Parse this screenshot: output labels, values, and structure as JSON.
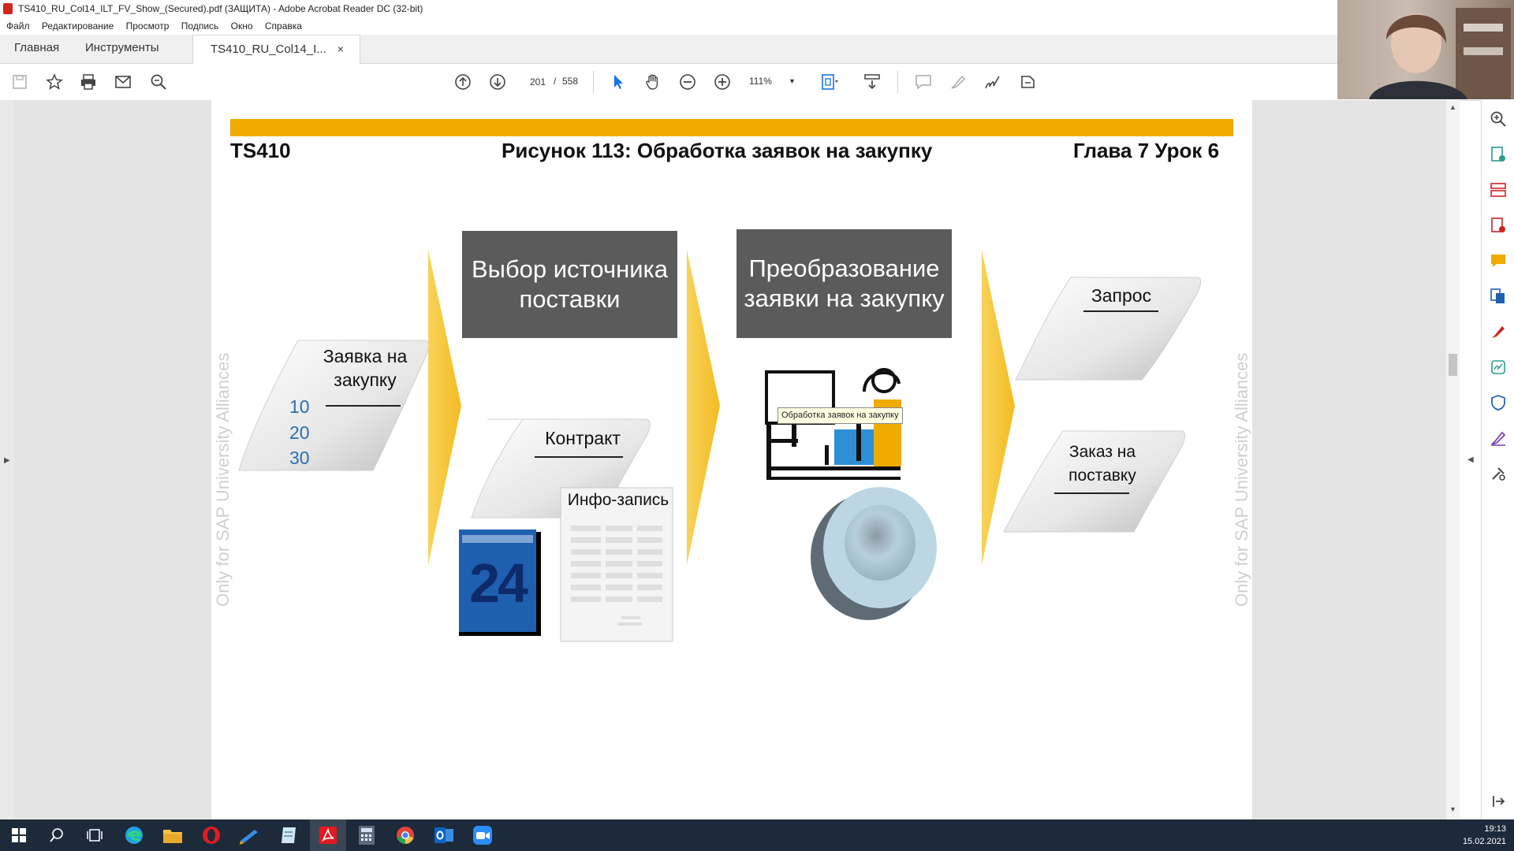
{
  "window": {
    "title": "TS410_RU_Col14_ILT_FV_Show_(Secured).pdf (ЗАЩИТА) - Adobe Acrobat Reader DC (32-bit)"
  },
  "menu": [
    "Файл",
    "Редактирование",
    "Просмотр",
    "Подпись",
    "Окно",
    "Справка"
  ],
  "tabs": {
    "home": "Главная",
    "tools": "Инструменты",
    "document": "TS410_RU_Col14_I...",
    "close": "×"
  },
  "toolbar": {
    "current_page": "201",
    "separator": "/",
    "total_pages": "558",
    "zoom": "111%",
    "icons": [
      "save-icon",
      "star-icon",
      "print-icon",
      "mail-icon",
      "search-icon",
      "page-up-icon",
      "page-down-icon",
      "select-cursor-icon",
      "hand-icon",
      "zoom-out-icon",
      "zoom-in-icon",
      "fit-page-icon",
      "scroll-mode-icon",
      "comment-icon",
      "highlight-icon",
      "sign-icon",
      "share-icon"
    ]
  },
  "slide": {
    "course": "TS410",
    "figure_title": "Рисунок 113: Обработка заявок на закупку",
    "chapter": "Глава 7 Урок 6",
    "watermark": "Only for SAP University Alliances",
    "box1": "Выбор источника поставки",
    "box2": "Преобразование заявки на закупку",
    "req_label": "Заявка на закупку",
    "req_items": [
      "10",
      "20",
      "30"
    ],
    "contract": "Контракт",
    "info_record": "Инфо-запись",
    "calendar_number": "24",
    "rfq": "Запрос",
    "po": "Заказ на поставку",
    "tooltip": "Обработка заявок на закупку"
  },
  "colors": {
    "accent_bar": "#f0ab00",
    "arrow_yellow": "#f6c534",
    "dark_box": "#5b5b5b",
    "number_blue": "#2a6fb0",
    "taskbar": "#1d2a3a"
  },
  "taskbar": {
    "time": "19:13",
    "date": "15.02.2021"
  }
}
